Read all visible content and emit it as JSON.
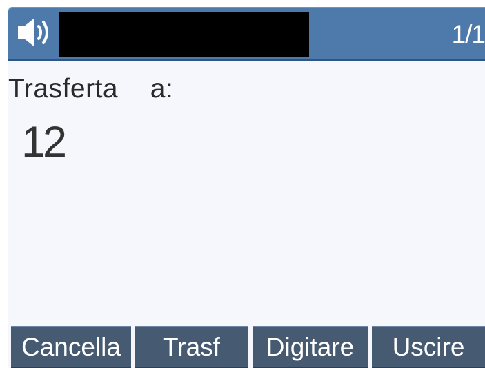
{
  "status_bar": {
    "page_indicator": "1/1",
    "icon": "speaker-icon"
  },
  "main": {
    "transfer_label": "Trasferta  a:",
    "entered_number": "12"
  },
  "softkeys": [
    {
      "label": "Cancella"
    },
    {
      "label": "Trasf"
    },
    {
      "label": "Digitare"
    },
    {
      "label": "Uscire"
    }
  ],
  "colors": {
    "header": "#4e79ab",
    "background": "#f5f7fd",
    "softkey": "#465a72",
    "text": "#2a2a2a"
  }
}
